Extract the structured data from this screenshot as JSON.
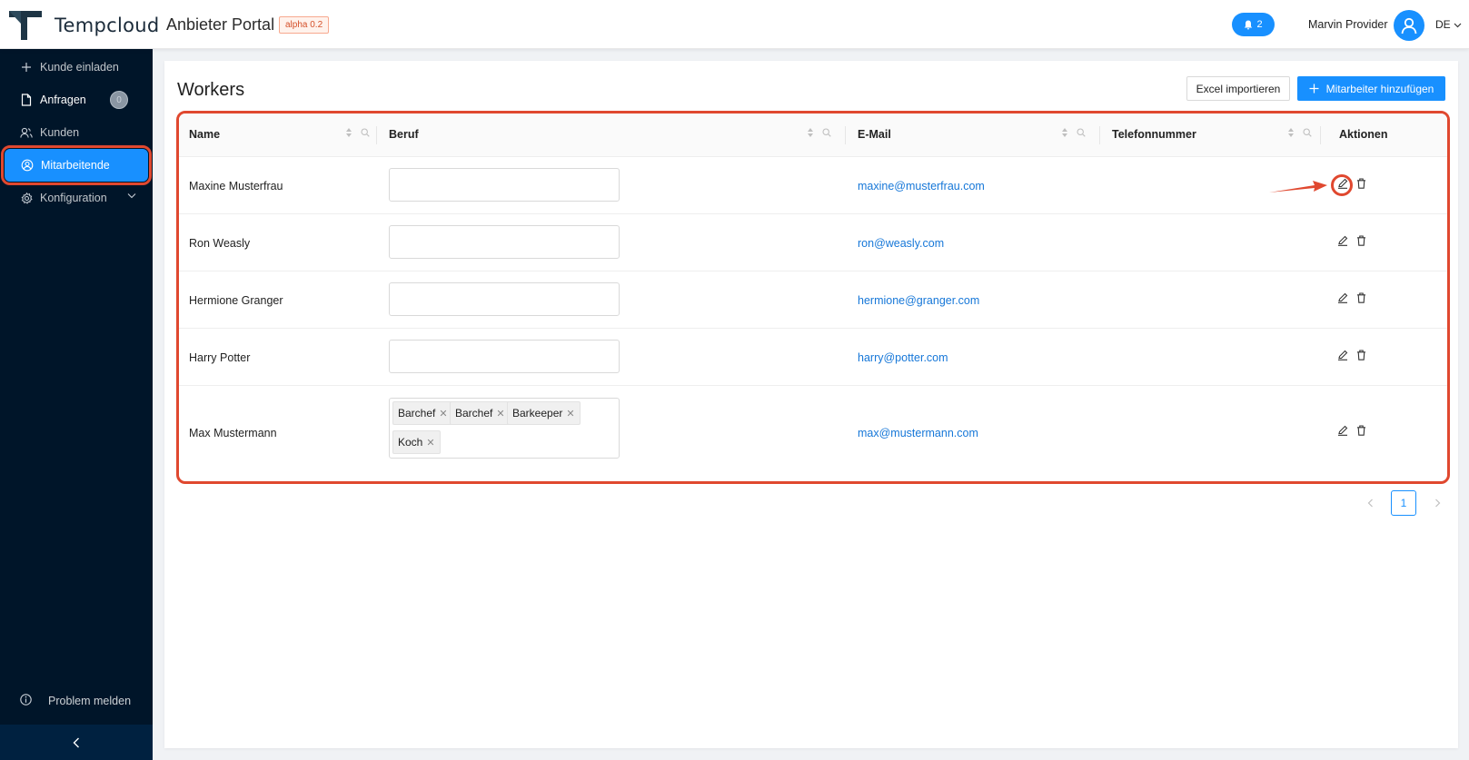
{
  "header": {
    "brand": "Tempcloud",
    "portal": "Anbieter Portal",
    "version_badge": "alpha 0.2",
    "notification_count": "2",
    "user_name": "Marvin Provider",
    "language": "DE"
  },
  "sidebar": {
    "items": [
      {
        "label": "Kunde einladen",
        "icon": "plus-icon"
      },
      {
        "label": "Anfragen",
        "icon": "document-icon",
        "badge": "0"
      },
      {
        "label": "Kunden",
        "icon": "users-icon"
      },
      {
        "label": "Mitarbeitende",
        "icon": "worker-icon",
        "active": true
      },
      {
        "label": "Konfiguration",
        "icon": "gear-icon"
      }
    ],
    "problem_label": "Problem melden"
  },
  "main": {
    "title": "Workers",
    "excel_button": "Excel importieren",
    "add_button": "Mitarbeiter hinzufügen"
  },
  "table": {
    "columns": [
      "Name",
      "Beruf",
      "E-Mail",
      "Telefonnummer",
      "Aktionen"
    ],
    "rows": [
      {
        "name": "Maxine Musterfrau",
        "email": "maxine@musterfrau.com",
        "tags": []
      },
      {
        "name": "Ron Weasly",
        "email": "ron@weasly.com",
        "tags": []
      },
      {
        "name": "Hermione Granger",
        "email": "hermione@granger.com",
        "tags": []
      },
      {
        "name": "Harry Potter",
        "email": "harry@potter.com",
        "tags": []
      },
      {
        "name": "Max Mustermann",
        "email": "max@mustermann.com",
        "tags": [
          "Barchef",
          "Barchef",
          "Barkeeper",
          "Koch"
        ]
      }
    ]
  },
  "pagination": {
    "current_page": "1"
  },
  "colors": {
    "primary": "#1890ff",
    "sidebar": "#001529",
    "highlight": "#e0482f",
    "link": "#1677d8"
  }
}
